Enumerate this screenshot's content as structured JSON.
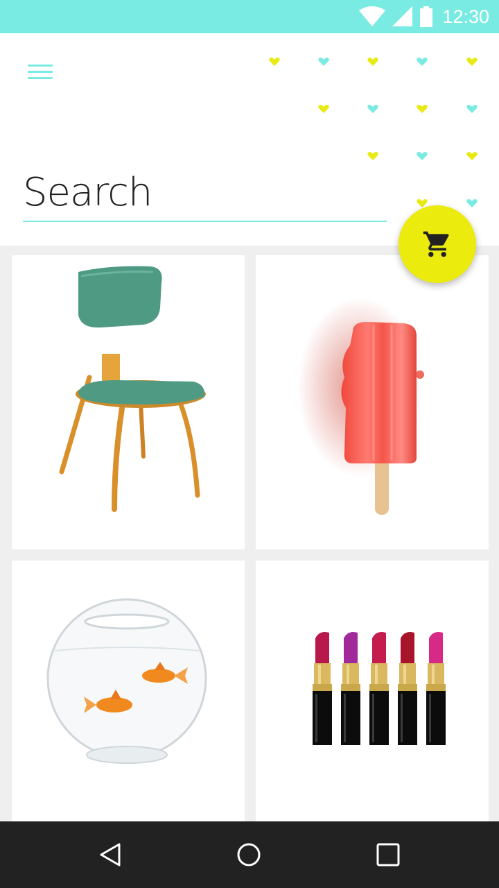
{
  "status_bar": {
    "time": "12:30",
    "icons": [
      "wifi-icon",
      "cellular-signal-icon",
      "battery-icon"
    ],
    "background": "#7aebe3"
  },
  "header": {
    "menu_icon": "hamburger-menu-icon",
    "search": {
      "placeholder": "Search",
      "value": ""
    },
    "accent_color": "#7aebe3",
    "pattern_colors": [
      "#e8ea13",
      "#7aebe3"
    ]
  },
  "fab": {
    "icon": "shopping-cart-icon",
    "color": "#ebeb0e"
  },
  "products": [
    {
      "name": "chair",
      "image": "green-chair-image"
    },
    {
      "name": "popsicle",
      "image": "red-popsicle-image"
    },
    {
      "name": "fishbowl",
      "image": "goldfish-bowl-image"
    },
    {
      "name": "lipsticks",
      "image": "lipsticks-image"
    }
  ],
  "nav_bar": {
    "buttons": [
      "back-icon",
      "home-icon",
      "recents-icon"
    ],
    "background": "#222222"
  }
}
